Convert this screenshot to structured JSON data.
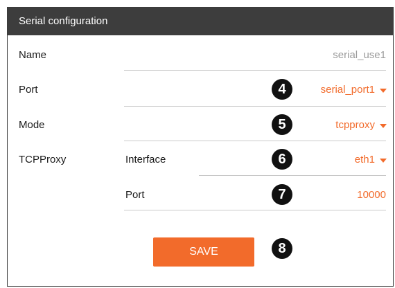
{
  "panel": {
    "title": "Serial configuration"
  },
  "form": {
    "name": {
      "label": "Name",
      "value": "serial_use1"
    },
    "port": {
      "label": "Port",
      "value": "serial_port1"
    },
    "mode": {
      "label": "Mode",
      "value": "tcpproxy"
    },
    "tcpproxy": {
      "label": "TCPProxy",
      "interface": {
        "label": "Interface",
        "value": "eth1"
      },
      "port": {
        "label": "Port",
        "value": "10000"
      }
    }
  },
  "actions": {
    "save_label": "SAVE"
  },
  "callouts": [
    "4",
    "5",
    "6",
    "7",
    "8"
  ],
  "colors": {
    "accent": "#f26b2b",
    "header_bg": "#3d3d3d",
    "value_grey": "#9a9a9a"
  },
  "icons": {
    "dropdown": "caret-down-icon"
  }
}
